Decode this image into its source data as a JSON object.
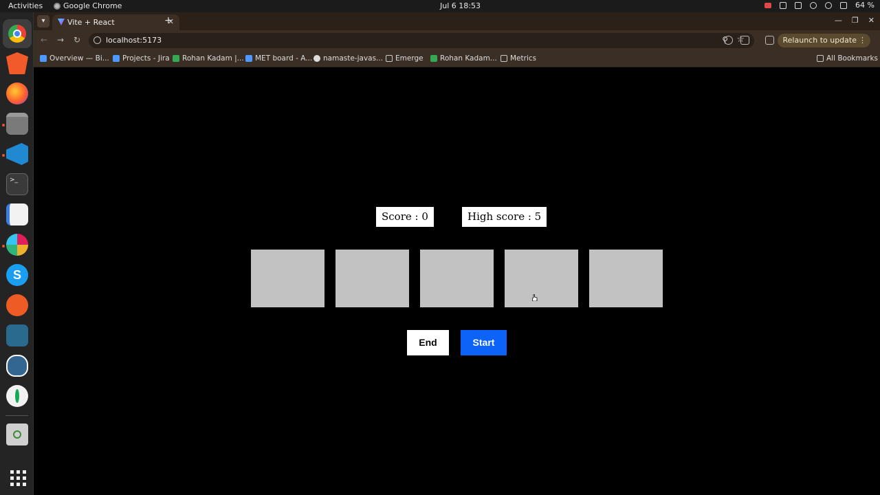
{
  "system_bar": {
    "activities": "Activities",
    "app_name": "Google Chrome",
    "clock": "Jul 6  18:53",
    "battery": "64 %"
  },
  "browser": {
    "tab_title": "Vite + React",
    "url": "localhost:5173",
    "relaunch_label": "Relaunch to update",
    "bookmarks": [
      {
        "label": "Overview — Bi...",
        "icon": "jira-icon"
      },
      {
        "label": "Projects - Jira",
        "icon": "jira-icon"
      },
      {
        "label": "Rohan Kadam |...",
        "icon": "sheets-icon"
      },
      {
        "label": "MET board - A...",
        "icon": "jira-icon"
      },
      {
        "label": "namaste-javas...",
        "icon": "github-icon"
      },
      {
        "label": "Emerge",
        "icon": "folder-icon"
      },
      {
        "label": "Rohan Kadam...",
        "icon": "sheets-icon"
      },
      {
        "label": "Metrics",
        "icon": "folder-icon"
      }
    ],
    "all_bookmarks": "All Bookmarks"
  },
  "game": {
    "score_text": "Score : 0",
    "high_score_text": "High score : 5",
    "tile_count": 5,
    "end_label": "End",
    "start_label": "Start"
  },
  "colors": {
    "tile": "#c2c2c2",
    "start_button": "#0d63f8",
    "page_background": "#000000"
  }
}
